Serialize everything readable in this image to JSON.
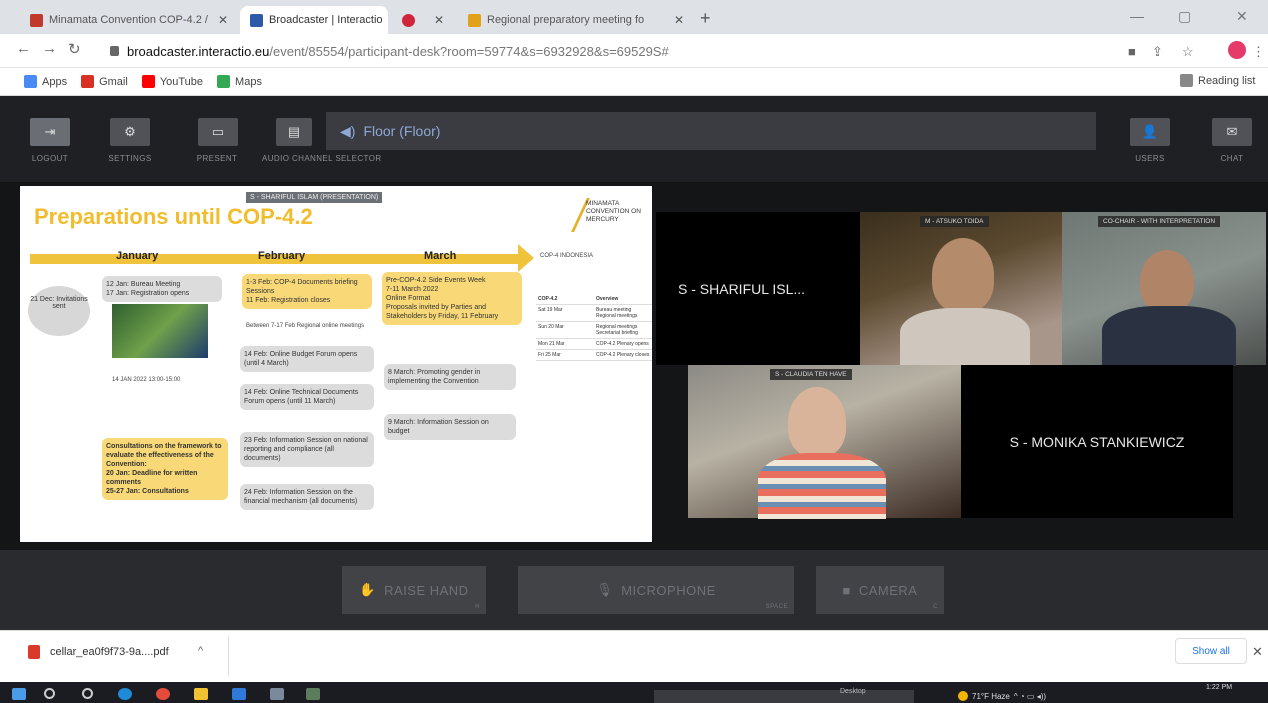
{
  "browser": {
    "tabs": [
      {
        "title": "Minamata Convention COP-4.2 /",
        "icon_color": "#c0392b"
      },
      {
        "title": "Broadcaster | Interactio",
        "icon_color": "#2d5aa8"
      },
      {
        "title": "",
        "icon_color": "#d0263b"
      },
      {
        "title": "Regional preparatory meeting fo",
        "icon_color": "#e0a21a"
      }
    ],
    "new_tab": "+",
    "url_host": "broadcaster.interactio.eu",
    "url_path": "/event/85554/participant-desk?room=59774&s=6932928&s=69529S#",
    "bookmarks": [
      {
        "label": "Apps",
        "color": "#4a8af4"
      },
      {
        "label": "Gmail",
        "color": "#d93025"
      },
      {
        "label": "YouTube",
        "color": "#ff0000"
      },
      {
        "label": "Maps",
        "color": "#34a853"
      }
    ],
    "reading_list": "Reading list"
  },
  "toolbar": {
    "logout": "LOGOUT",
    "settings": "SETTINGS",
    "present": "PRESENT",
    "audio_selector": "AUDIO CHANNEL SELECTOR",
    "floor": "Floor (Floor)",
    "users": "USERS",
    "chat": "CHAT"
  },
  "slide": {
    "title": "Preparations until COP-4.2",
    "presenter_label": "S - SHARIFUL ISLAM (PRESENTATION)",
    "logo_text": "MINAMATA CONVENTION ON MERCURY",
    "months": [
      "January",
      "February",
      "March"
    ],
    "circle_text": "21 Dec: Invitations sent",
    "jan_box": "12 Jan: Bureau Meeting\n17 Jan: Registration opens",
    "jan_consult": "Consultations on the framework to evaluate the effectiveness of the Convention:\n20 Jan: Deadline for written comments\n25-27 Jan: Consultations",
    "jan_date": "14 JAN 2022 13:00-15:00",
    "feb_top": "1-3 Feb: COP-4 Documents briefing Sessions\n11 Feb: Registration closes",
    "feb_regional": "Between 7-17 Feb   Regional online meetings",
    "feb_budget": "14 Feb: Online Budget Forum opens (until 4 March)",
    "feb_technical": "14 Feb: Online Technical Documents Forum opens (until 11 March)",
    "feb_info1": "23 Feb: Information Session on national reporting and compliance (all documents)",
    "feb_info2": "24 Feb: Information Session on the financial mechanism (all documents)",
    "mar_top": "Pre-COP-4.2 Side Events Week\n7-11 March 2022\nOnline Format\nProposals invited by Parties and Stakeholders by Friday, 11 February",
    "mar_gender": "8 March: Promoting gender in implementing the Convention",
    "mar_budget": "9 March: Information Session on budget",
    "side_logo": "COP-4 INDONESIA",
    "side_table_head": [
      "COP-4.2",
      "Overview"
    ],
    "side_table_rows": [
      [
        "Sat 19 Mar",
        "Bureau meeting Regional meetings"
      ],
      [
        "Sun 20 Mar",
        "Regional meetings Secretariat briefing"
      ],
      [
        "Mon 21 Mar",
        "COP-4.2 Plenary opens"
      ],
      [
        "Fri 25 Mar",
        "COP-4.2 Plenary closes"
      ]
    ]
  },
  "video": {
    "tile1": "S - SHARIFUL ISL...",
    "tile2_label": "M - ATSUKO TOIDA",
    "tile3_label": "CO-CHAIR - WITH INTERPRETATION",
    "tile4_label": "S - CLAUDIA TEN HAVE",
    "tile5": "S - MONIKA STANKIEWICZ"
  },
  "controls": {
    "raise_hand": "RAISE HAND",
    "raise_hand_key": "H",
    "microphone": "MICROPHONE",
    "microphone_key": "SPACE",
    "camera": "CAMERA",
    "camera_key": "C"
  },
  "download": {
    "filename": "cellar_ea0f9f73-9a....pdf",
    "show_all": "Show all"
  },
  "taskbar": {
    "search_hint": "Desktop",
    "weather": "71°F Haze",
    "time": "1:22 PM"
  }
}
